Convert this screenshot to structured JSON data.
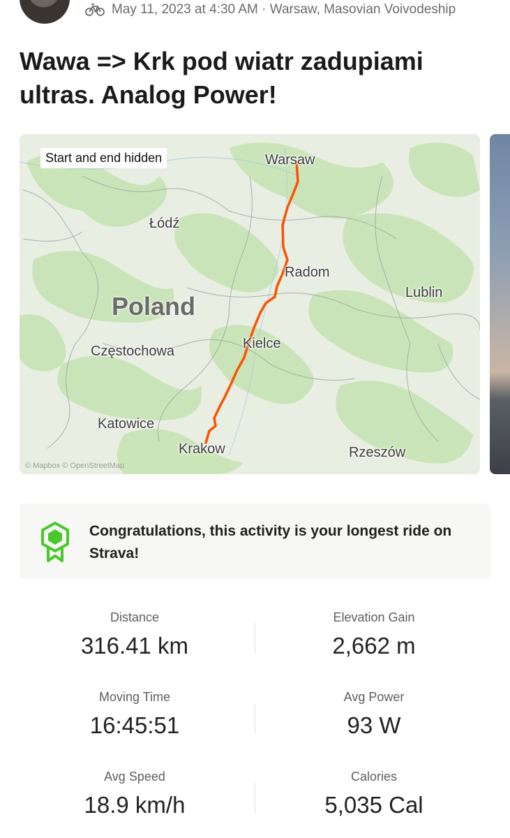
{
  "activity": {
    "meta": "May 11, 2023 at 4:30 AM · Warsaw, Masovian Voivodeship",
    "title": "Wawa => Krk pod wiatr zadupiami ultras. Analog Power!",
    "sport_icon": "bicycle-icon"
  },
  "map": {
    "badge": "Start and end hidden",
    "country": "Poland",
    "credit": "© Mapbox © OpenStreetMap",
    "route_color": "#fc5200",
    "cities": {
      "warsaw": "Warsaw",
      "lodz": "Łódź",
      "radom": "Radom",
      "lublin": "Lublin",
      "kielce": "Kielce",
      "czestochowa": "Częstochowa",
      "katowice": "Katowice",
      "krakow": "Krakow",
      "rzeszow": "Rzeszów"
    }
  },
  "achievement": {
    "text": "Congratulations, this activity is your longest ride on Strava!",
    "icon": "achievement-badge-icon",
    "icon_color": "#49c82a"
  },
  "stats": [
    {
      "label": "Distance",
      "value": "316.41 km"
    },
    {
      "label": "Elevation Gain",
      "value": "2,662 m"
    },
    {
      "label": "Moving Time",
      "value": "16:45:51"
    },
    {
      "label": "Avg Power",
      "value": "93 W"
    },
    {
      "label": "Avg Speed",
      "value": "18.9 km/h"
    },
    {
      "label": "Calories",
      "value": "5,035 Cal"
    }
  ]
}
